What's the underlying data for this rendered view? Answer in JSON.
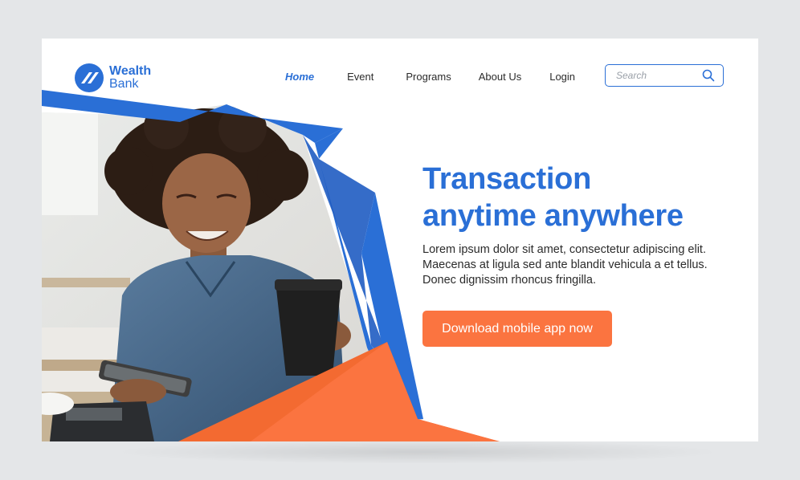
{
  "brand": {
    "name_line1": "Wealth",
    "name_line2": "Bank",
    "logo_icon": "wealth-bank-logo-icon",
    "color": "#2a6fd6"
  },
  "nav": {
    "items": [
      {
        "label": "Home",
        "active": true
      },
      {
        "label": "Event",
        "active": false
      },
      {
        "label": "Programs",
        "active": false
      },
      {
        "label": "About Us",
        "active": false
      },
      {
        "label": "Login",
        "active": false
      }
    ]
  },
  "search": {
    "placeholder": "Search",
    "icon": "search-icon"
  },
  "hero": {
    "headline_line1": "Transaction",
    "headline_line2": "anytime anywhere",
    "body_line1": "Lorem ipsum dolor sit amet, consectetur adipiscing elit.",
    "body_line2": "Maecenas at ligula sed ante blandit vehicula a et tellus.",
    "body_line3": "Donec dignissim rhoncus fringilla.",
    "cta_label": "Download mobile app now"
  },
  "colors": {
    "primary_blue": "#2a6fd6",
    "dark_blue": "#1f5cc2",
    "accent_orange": "#fb7440",
    "background": "#ffffff"
  }
}
